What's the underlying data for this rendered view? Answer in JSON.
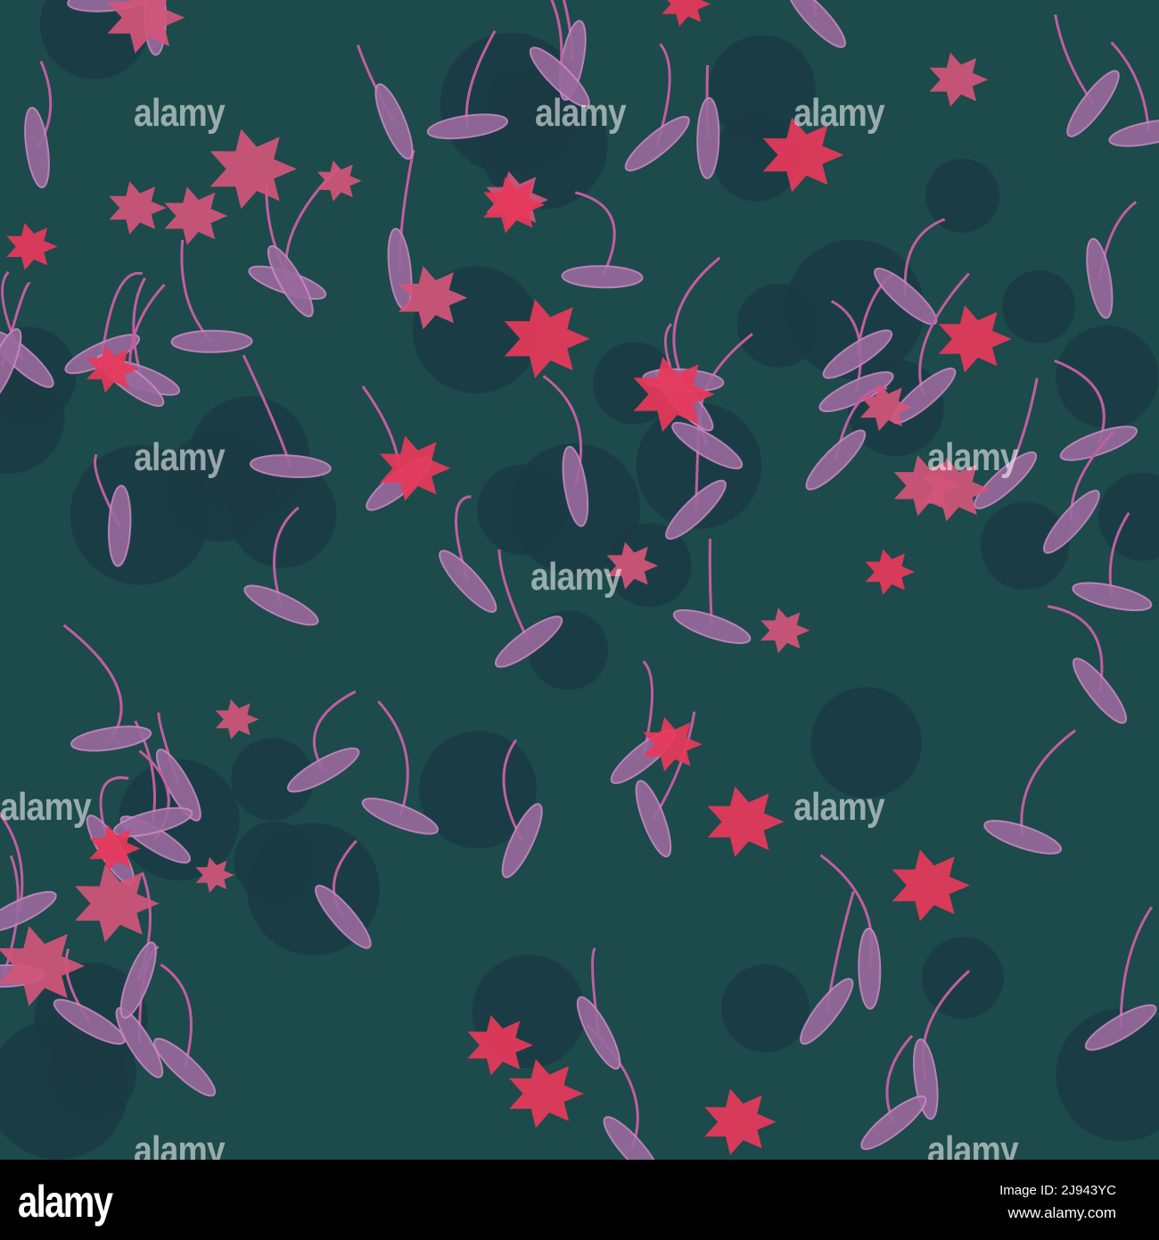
{
  "watermark_text": "alamy",
  "footer": {
    "logo": "alamy",
    "image_id": "Image ID: 2J943YC",
    "url": "www.alamy.com"
  },
  "colors": {
    "background": "#1d4a4b",
    "flower_red": "#e8385a",
    "flower_pink": "#d2557a",
    "leaf_mauve": "#9a6a9e",
    "dark_flower": "#1a3a44",
    "stem": "#c25ea0"
  }
}
